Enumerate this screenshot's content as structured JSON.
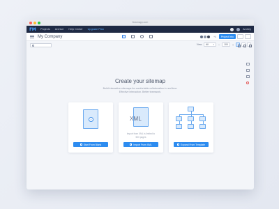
{
  "browser": {
    "url": "flowmapp.com"
  },
  "topnav": {
    "logo": "FM",
    "items": [
      "Projects",
      "Archive",
      "Help Center",
      "Upgrade Plan"
    ],
    "user_name": "Andrey"
  },
  "toolbar": {
    "company": "My Company",
    "avatar_more": "+4",
    "project_button": "Project Info"
  },
  "filters": {
    "view_label": "View:",
    "view_value": "All",
    "zoom_minus": "−",
    "zoom_value": "100",
    "zoom_plus": "+"
  },
  "main": {
    "title": "Create your sitemap",
    "subtitle_line1": "Build interactive sitemaps for comfortable collaboration in real time.",
    "subtitle_line2": "Effective interaction. Better teamwork."
  },
  "cards": [
    {
      "button": "Start From Blank",
      "icon": "blank-page-icon"
    },
    {
      "doc_label": "XML",
      "note_line1": "Import from XML is limited to",
      "note_line2": "500 pages",
      "button": "Import From XML",
      "icon": "xml-file-icon"
    },
    {
      "button": "Expand From Template",
      "icon": "sitemap-tree-icon"
    }
  ],
  "colors": {
    "primary": "#2d8cf0",
    "nav_bg": "#1f2a44",
    "illustration_fill": "#d9eafc",
    "illustration_stroke": "#6aa9ef"
  }
}
